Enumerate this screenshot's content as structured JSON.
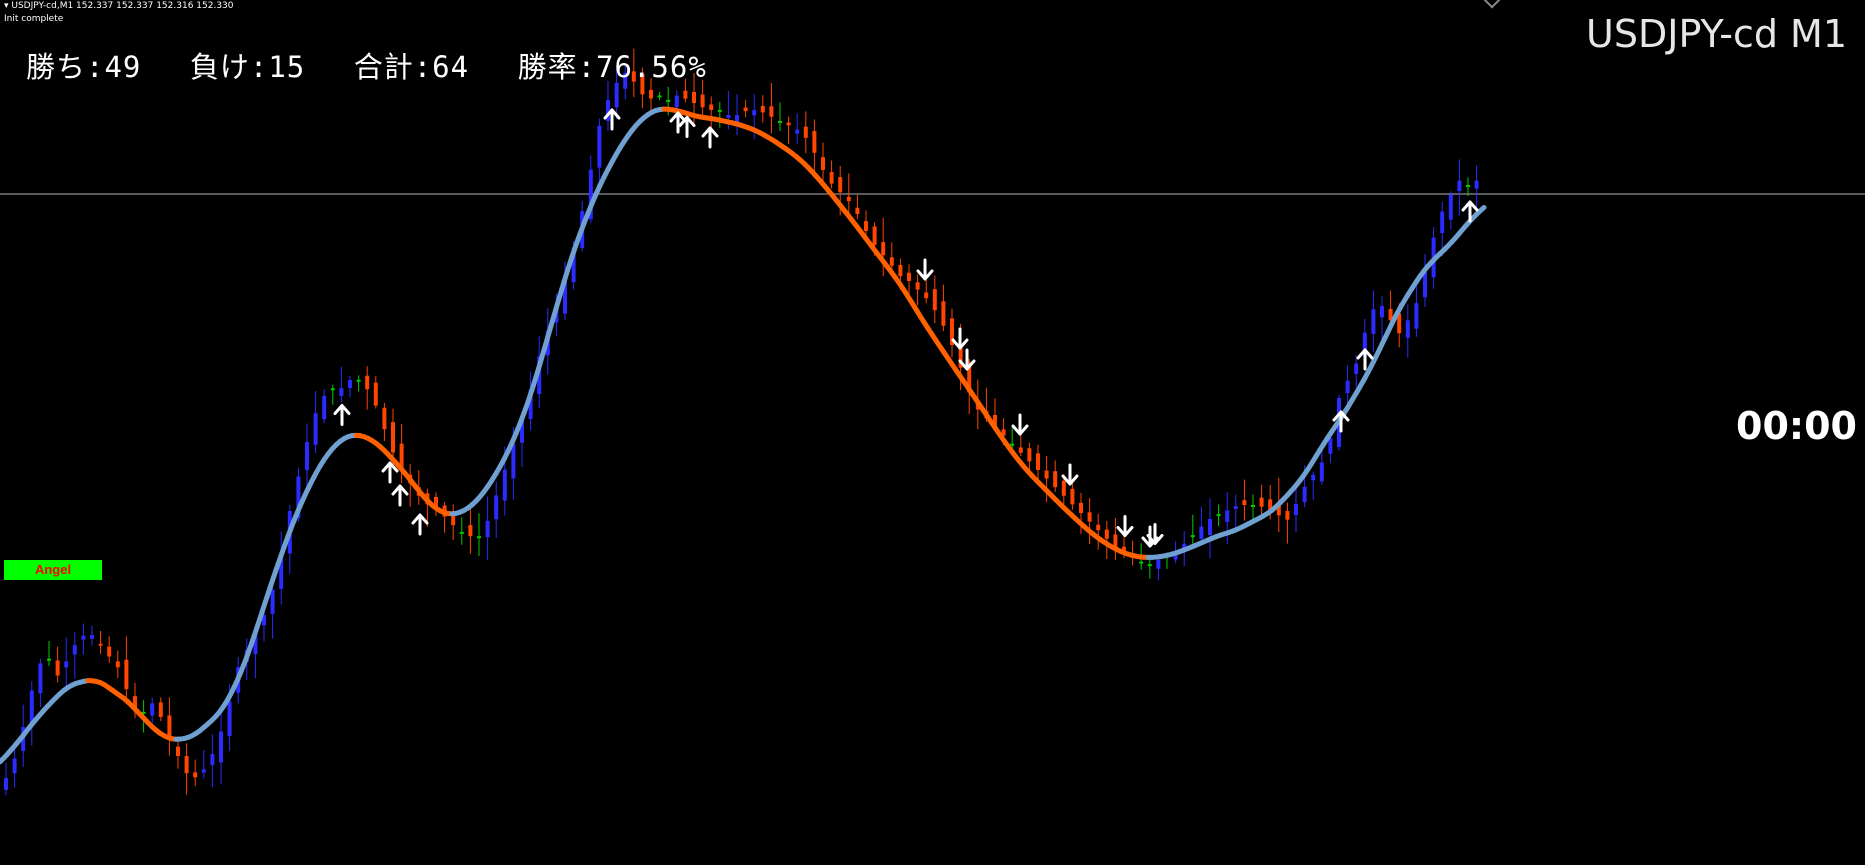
{
  "header": {
    "line1": "▾ USDJPY-cd,M1  152.337 152.337 152.316 152.330",
    "line2": "Init complete"
  },
  "stats": {
    "wins": "勝ち:49",
    "losses": "負け:15",
    "total": "合計:64",
    "rate": "勝率:76.56%"
  },
  "symbol_label": "USDJPY-cd M1",
  "timer": "00:00",
  "badge": "Angel",
  "colors": {
    "background": "#000000",
    "bull_candle": "#2b2bff",
    "bear_candle": "#ff4500",
    "doji_candle": "#00cc00",
    "ma_up": "#6fa0d0",
    "ma_down": "#ff6000",
    "arrow": "#ffffff",
    "price_line": "#c0c0c0",
    "badge_bg": "#00ff00",
    "badge_text": "#ff0000"
  },
  "chart_data": {
    "type": "candlestick",
    "symbol": "USDJPY-cd",
    "timeframe": "M1",
    "current_price": 152.33,
    "ohlc_last": [
      152.337,
      152.337,
      152.316,
      152.33
    ],
    "close_path": [
      [
        0,
        790
      ],
      [
        10,
        770
      ],
      [
        20,
        745
      ],
      [
        28,
        700
      ],
      [
        36,
        680
      ],
      [
        44,
        650
      ],
      [
        52,
        665
      ],
      [
        60,
        680
      ],
      [
        70,
        650
      ],
      [
        80,
        640
      ],
      [
        88,
        630
      ],
      [
        96,
        640
      ],
      [
        104,
        650
      ],
      [
        112,
        660
      ],
      [
        120,
        670
      ],
      [
        130,
        700
      ],
      [
        140,
        720
      ],
      [
        150,
        700
      ],
      [
        160,
        715
      ],
      [
        170,
        740
      ],
      [
        180,
        760
      ],
      [
        190,
        780
      ],
      [
        200,
        775
      ],
      [
        210,
        760
      ],
      [
        220,
        735
      ],
      [
        230,
        700
      ],
      [
        240,
        660
      ],
      [
        250,
        645
      ],
      [
        260,
        625
      ],
      [
        270,
        600
      ],
      [
        280,
        560
      ],
      [
        290,
        510
      ],
      [
        300,
        470
      ],
      [
        310,
        430
      ],
      [
        320,
        400
      ],
      [
        330,
        390
      ],
      [
        340,
        390
      ],
      [
        348,
        380
      ],
      [
        358,
        380
      ],
      [
        368,
        390
      ],
      [
        378,
        410
      ],
      [
        388,
        440
      ],
      [
        398,
        465
      ],
      [
        408,
        480
      ],
      [
        418,
        495
      ],
      [
        428,
        505
      ],
      [
        438,
        510
      ],
      [
        448,
        520
      ],
      [
        458,
        530
      ],
      [
        468,
        535
      ],
      [
        478,
        540
      ],
      [
        488,
        520
      ],
      [
        498,
        490
      ],
      [
        508,
        460
      ],
      [
        518,
        430
      ],
      [
        528,
        400
      ],
      [
        538,
        360
      ],
      [
        548,
        330
      ],
      [
        558,
        300
      ],
      [
        568,
        270
      ],
      [
        578,
        230
      ],
      [
        588,
        185
      ],
      [
        598,
        130
      ],
      [
        608,
        100
      ],
      [
        618,
        80
      ],
      [
        628,
        70
      ],
      [
        638,
        90
      ],
      [
        648,
        100
      ],
      [
        658,
        95
      ],
      [
        668,
        100
      ],
      [
        678,
        95
      ],
      [
        688,
        100
      ],
      [
        698,
        105
      ],
      [
        708,
        110
      ],
      [
        718,
        110
      ],
      [
        728,
        115
      ],
      [
        738,
        115
      ],
      [
        748,
        110
      ],
      [
        758,
        110
      ],
      [
        768,
        115
      ],
      [
        778,
        120
      ],
      [
        788,
        125
      ],
      [
        798,
        130
      ],
      [
        808,
        140
      ],
      [
        818,
        160
      ],
      [
        828,
        180
      ],
      [
        838,
        190
      ],
      [
        848,
        200
      ],
      [
        858,
        215
      ],
      [
        868,
        235
      ],
      [
        878,
        250
      ],
      [
        888,
        260
      ],
      [
        898,
        275
      ],
      [
        908,
        280
      ],
      [
        918,
        290
      ],
      [
        928,
        300
      ],
      [
        938,
        315
      ],
      [
        948,
        335
      ],
      [
        958,
        360
      ],
      [
        968,
        390
      ],
      [
        978,
        410
      ],
      [
        988,
        420
      ],
      [
        998,
        430
      ],
      [
        1008,
        440
      ],
      [
        1018,
        450
      ],
      [
        1028,
        460
      ],
      [
        1038,
        470
      ],
      [
        1048,
        480
      ],
      [
        1058,
        490
      ],
      [
        1068,
        500
      ],
      [
        1078,
        510
      ],
      [
        1088,
        520
      ],
      [
        1098,
        530
      ],
      [
        1108,
        540
      ],
      [
        1118,
        550
      ],
      [
        1128,
        555
      ],
      [
        1138,
        560
      ],
      [
        1148,
        565
      ],
      [
        1158,
        560
      ],
      [
        1168,
        555
      ],
      [
        1178,
        550
      ],
      [
        1188,
        540
      ],
      [
        1198,
        530
      ],
      [
        1208,
        520
      ],
      [
        1218,
        515
      ],
      [
        1228,
        510
      ],
      [
        1238,
        505
      ],
      [
        1248,
        505
      ],
      [
        1258,
        505
      ],
      [
        1268,
        510
      ],
      [
        1278,
        515
      ],
      [
        1288,
        520
      ],
      [
        1298,
        500
      ],
      [
        1308,
        480
      ],
      [
        1318,
        470
      ],
      [
        1328,
        450
      ],
      [
        1338,
        400
      ],
      [
        1348,
        380
      ],
      [
        1358,
        360
      ],
      [
        1368,
        320
      ],
      [
        1378,
        300
      ],
      [
        1388,
        315
      ],
      [
        1398,
        335
      ],
      [
        1408,
        320
      ],
      [
        1418,
        300
      ],
      [
        1428,
        260
      ],
      [
        1438,
        220
      ],
      [
        1448,
        200
      ],
      [
        1458,
        180
      ],
      [
        1468,
        185
      ],
      [
        1478,
        180
      ],
      [
        1485,
        185
      ]
    ],
    "arrows_up": [
      342,
      390,
      400,
      420,
      612,
      678,
      687,
      710,
      1341,
      1365,
      1470
    ],
    "arrows_down": [
      925,
      960,
      967,
      1020,
      1070,
      1125,
      1150,
      1155
    ]
  }
}
